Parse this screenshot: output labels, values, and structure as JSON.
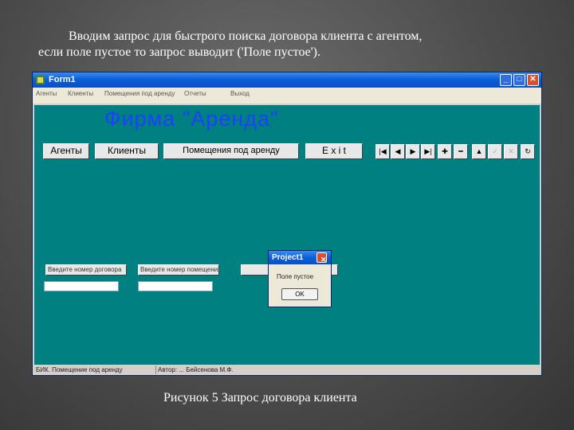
{
  "caption": {
    "line1": "Вводим запрос для быстрого поиска договора клиента с агентом,",
    "line2": "если поле пустое то запрос выводит ('Поле пустое').",
    "figure": "Рисунок 5 Запрос договора клиента"
  },
  "window": {
    "title": "Form1",
    "menu": [
      "Агенты",
      "Клиенты",
      "Помещения под аренду",
      "Отчеты",
      "Выход"
    ],
    "firm_title": "Фирма \"Аренда\"",
    "buttons": {
      "agents": "Агенты",
      "clients": "Клиенты",
      "premises": "Помещения под аренду",
      "exit": "E x i t"
    },
    "navigator": [
      "first-icon",
      "prior-icon",
      "next-icon",
      "last-icon",
      "insert-icon",
      "delete-icon",
      "edit-icon",
      "post-icon",
      "cancel-icon",
      "refresh-icon"
    ],
    "query": {
      "contract_label": "Введите номер договора",
      "premise_label": "Введите номер помещения"
    },
    "status": {
      "left": "БИК. Помещение под аренду",
      "right": "Автор: ... Бейсенова М.Ф."
    }
  },
  "dialog": {
    "title": "Project1",
    "message": "Поле пустое",
    "ok": "OK"
  },
  "colors": {
    "client_bg": "#008080",
    "title_bar": "#0b5fd8",
    "firm_title": "#1e40ff"
  }
}
